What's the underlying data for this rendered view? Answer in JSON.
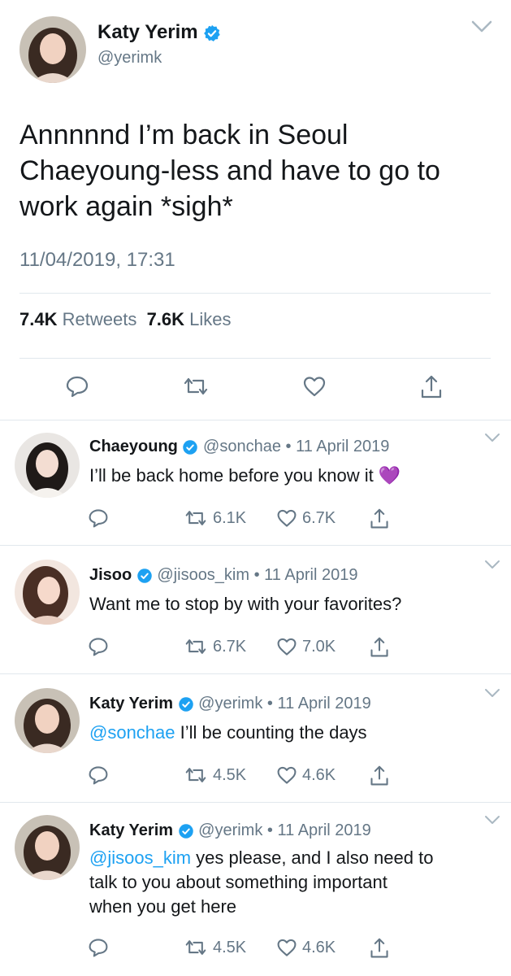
{
  "main_tweet": {
    "author_name": "Katy Yerim",
    "handle": "@yerimk",
    "text_lines": [
      "Annnnnd I’m back in Seoul",
      "Chaeyoung-less and have to go to",
      "work again *sigh*"
    ],
    "timestamp": "11/04/2019, 17:31",
    "retweet_count": "7.4K",
    "retweet_label": "Retweets",
    "like_count": "7.6K",
    "like_label": "Likes"
  },
  "replies": [
    {
      "author_name": "Chaeyoung",
      "handle": "@sonchae",
      "date": "• 11 April 2019",
      "mention": "",
      "text_lines": [
        "I’ll be back home before you know it 💜"
      ],
      "retweets": "6.1K",
      "likes": "6.7K"
    },
    {
      "author_name": "Jisoo",
      "handle": "@jisoos_kim",
      "date": "• 11 April 2019",
      "mention": "",
      "text_lines": [
        "Want me to stop by with your favorites?"
      ],
      "retweets": "6.7K",
      "likes": "7.0K"
    },
    {
      "author_name": "Katy Yerim",
      "handle": "@yerimk",
      "date": "• 11 April 2019",
      "mention": "@sonchae",
      "text_lines": [
        " I’ll be counting the days"
      ],
      "retweets": "4.5K",
      "likes": "4.6K"
    },
    {
      "author_name": "Katy Yerim",
      "handle": "@yerimk",
      "date": "• 11 April 2019",
      "mention": "@jisoos_kim",
      "text_lines": [
        " yes please, and I also need to",
        "talk to you about something important",
        "when you get here"
      ],
      "retweets": "4.5K",
      "likes": "4.6K"
    }
  ],
  "colors": {
    "link": "#1da1f2",
    "verified": "#1da1f2",
    "muted": "#657786",
    "divider": "#e1e8ed"
  },
  "icons": [
    "chevron-down-icon",
    "verified-icon",
    "reply-icon",
    "retweet-icon",
    "like-icon",
    "share-icon"
  ]
}
